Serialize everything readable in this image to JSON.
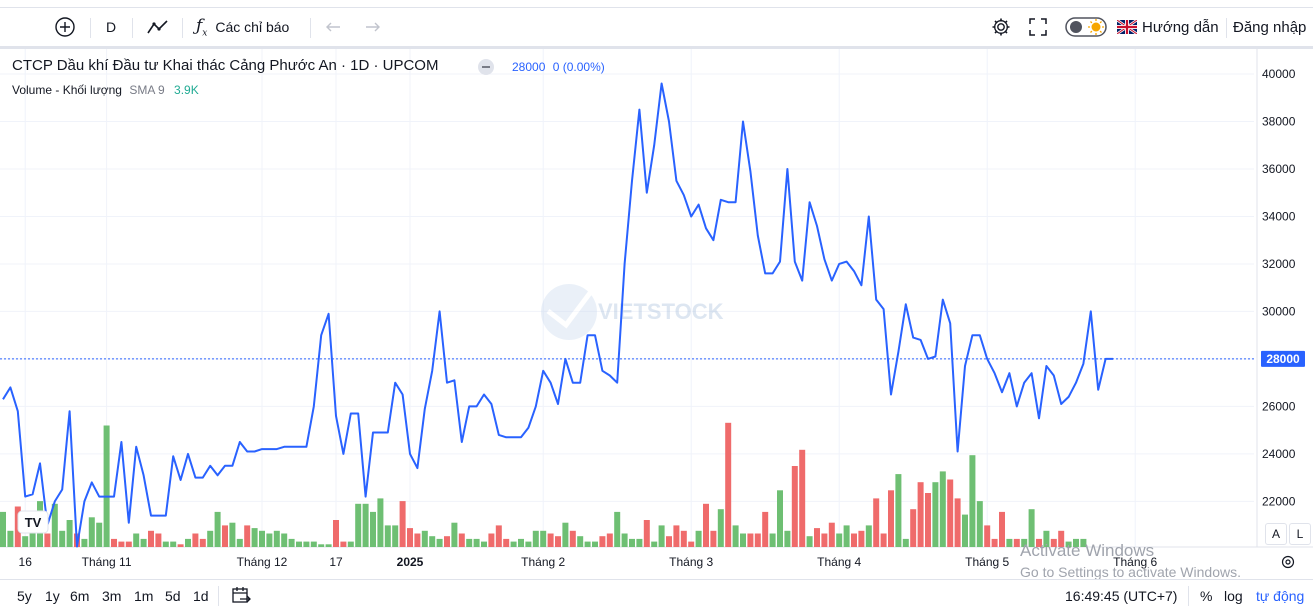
{
  "toolbar": {
    "interval": "D",
    "indicators_label": "Các chỉ báo",
    "guide_label": "Hướng dẫn",
    "login_label": "Đăng nhập"
  },
  "legend": {
    "title": "CTCP Dầu khí Đầu tư Khai thác Cảng Phước An · 1D · UPCOM",
    "last_price": "28000",
    "change": "0 (0.00%)",
    "volume_label": "Volume - Khối lượng",
    "volume_sma": "SMA 9",
    "volume_value": "3.9K"
  },
  "watermark": "VIETSTOCK",
  "bottombar": {
    "ranges": [
      "5y",
      "1y",
      "6m",
      "3m",
      "1m",
      "5d",
      "1d"
    ],
    "clock": "16:49:45 (UTC+7)",
    "percent_label": "%",
    "log_label": "log",
    "auto_label": "tự động"
  },
  "scale_buttons": {
    "a": "A",
    "l": "L"
  },
  "activate_windows": {
    "title": "Activate Windows",
    "subtitle": "Go to Settings to activate Windows."
  },
  "colors": {
    "line": "#2962ff",
    "vol_up": "#6ebf73",
    "vol_down": "#ef6b6b"
  },
  "chart_data": {
    "type": "line",
    "title": "CTCP Dầu khí Đầu tư Khai thác Cảng Phước An · 1D · UPCOM",
    "ylim": [
      20500,
      40800
    ],
    "yticks": [
      22000,
      24000,
      26000,
      28000,
      30000,
      32000,
      34000,
      36000,
      38000,
      40000
    ],
    "last_price_label": "28000",
    "grid": true,
    "xtick_labels": [
      {
        "label": "16",
        "index": 3
      },
      {
        "label": "Tháng 11",
        "index": 14
      },
      {
        "label": "Tháng 12",
        "index": 35
      },
      {
        "label": "17",
        "index": 45
      },
      {
        "label": "2025",
        "index": 55
      },
      {
        "label": "Tháng 2",
        "index": 73
      },
      {
        "label": "Tháng 3",
        "index": 93
      },
      {
        "label": "Tháng 4",
        "index": 113
      },
      {
        "label": "Tháng 5",
        "index": 133
      },
      {
        "label": "Tháng 6",
        "index": 153
      }
    ],
    "close": [
      26300,
      26800,
      25800,
      22200,
      22300,
      23600,
      21000,
      22000,
      22500,
      25800,
      20100,
      22000,
      22800,
      22200,
      22200,
      22200,
      24500,
      21100,
      24300,
      23100,
      21400,
      21400,
      21400,
      23900,
      22900,
      24000,
      23000,
      23000,
      23500,
      23100,
      23500,
      23500,
      24500,
      24100,
      24100,
      24200,
      24200,
      24200,
      24300,
      24300,
      24300,
      24300,
      26000,
      29000,
      29900,
      25600,
      24000,
      25700,
      25700,
      22200,
      24900,
      24900,
      24900,
      27000,
      26500,
      24000,
      23400,
      25900,
      27500,
      30000,
      27000,
      27100,
      24500,
      26000,
      26000,
      26500,
      26100,
      24800,
      24700,
      24700,
      24700,
      25100,
      26000,
      27500,
      27000,
      26100,
      28000,
      27000,
      27000,
      29000,
      29000,
      27500,
      27300,
      27000,
      32000,
      35500,
      38500,
      35000,
      37000,
      39600,
      38000,
      35500,
      34900,
      34000,
      34500,
      33500,
      33000,
      34700,
      34600,
      34600,
      38000,
      35900,
      33200,
      31600,
      31600,
      32100,
      36000,
      32100,
      31300,
      34600,
      33600,
      32200,
      31300,
      32000,
      32100,
      31700,
      31100,
      34000,
      30500,
      30100,
      26500,
      28300,
      30300,
      28900,
      28800,
      28000,
      28100,
      30500,
      29500,
      24100,
      27700,
      29000,
      29000,
      28000,
      27400,
      26600,
      27400,
      26000,
      27000,
      27400,
      25500,
      27700,
      27300,
      26100,
      26400,
      27000,
      27800,
      30000,
      26700,
      28000,
      28000
    ],
    "volume": [
      1.3,
      0.6,
      1.5,
      0.4,
      0.9,
      1.7,
      0.5,
      1.6,
      0.6,
      1.0,
      0.5,
      0.3,
      1.1,
      0.9,
      4.5,
      0.3,
      0.2,
      0.2,
      0.5,
      0.3,
      0.6,
      0.5,
      0.2,
      0.2,
      0.1,
      0.3,
      0.5,
      0.3,
      0.6,
      1.3,
      0.8,
      0.9,
      0.3,
      0.8,
      0.7,
      0.6,
      0.5,
      0.6,
      0.5,
      0.3,
      0.2,
      0.2,
      0.2,
      0.1,
      0.1,
      1.0,
      0.2,
      0.2,
      1.6,
      1.6,
      1.3,
      1.8,
      0.8,
      0.8,
      1.7,
      0.7,
      0.5,
      0.6,
      0.4,
      0.3,
      0.4,
      0.9,
      0.5,
      0.3,
      0.3,
      0.2,
      0.5,
      0.8,
      0.3,
      0.2,
      0.3,
      0.2,
      0.6,
      0.6,
      0.5,
      0.4,
      0.9,
      0.6,
      0.4,
      0.2,
      0.2,
      0.4,
      0.5,
      1.3,
      0.5,
      0.3,
      0.3,
      1.0,
      0.2,
      0.8,
      0.4,
      0.8,
      0.6,
      0.2,
      0.6,
      1.6,
      0.6,
      1.4,
      4.6,
      0.8,
      0.5,
      0.5,
      0.5,
      1.3,
      0.5,
      2.1,
      0.6,
      3.0,
      3.6,
      0.4,
      0.7,
      0.5,
      0.9,
      0.5,
      0.8,
      0.5,
      0.6,
      0.8,
      1.8,
      0.5,
      2.1,
      2.7,
      0.3,
      1.4,
      2.4,
      2.0,
      2.4,
      2.8,
      2.5,
      1.8,
      1.2,
      3.4,
      1.7,
      0.8,
      0.3,
      1.3,
      0.3,
      0.3,
      0.3,
      1.4,
      0.3,
      0.6,
      0.3,
      0.6,
      0.2,
      0.3,
      0.3
    ],
    "volume_up": [
      1,
      1,
      0,
      1,
      1,
      1,
      0,
      1,
      1,
      1,
      0,
      1,
      1,
      1,
      1,
      0,
      0,
      0,
      1,
      1,
      0,
      0,
      1,
      1,
      0,
      1,
      0,
      0,
      1,
      1,
      0,
      1,
      1,
      0,
      1,
      1,
      1,
      1,
      1,
      1,
      1,
      1,
      1,
      1,
      1,
      0,
      0,
      1,
      1,
      1,
      1,
      1,
      1,
      1,
      0,
      0,
      0,
      1,
      1,
      1,
      0,
      1,
      0,
      1,
      1,
      1,
      0,
      0,
      0,
      1,
      1,
      1,
      1,
      1,
      0,
      0,
      1,
      0,
      1,
      1,
      1,
      0,
      0,
      1,
      1,
      1,
      1,
      0,
      1,
      1,
      0,
      0,
      0,
      0,
      1,
      0,
      0,
      1,
      0,
      1,
      1,
      0,
      0,
      0,
      1,
      1,
      1,
      0,
      0,
      1,
      0,
      0,
      0,
      1,
      1,
      0,
      0,
      1,
      0,
      0,
      0,
      1,
      1,
      0,
      0,
      0,
      1,
      1,
      0,
      0,
      1,
      1,
      1,
      0,
      0,
      0,
      1,
      0,
      1,
      1,
      0,
      1,
      0,
      0,
      1,
      1,
      1,
      1,
      0,
      1,
      1
    ]
  }
}
